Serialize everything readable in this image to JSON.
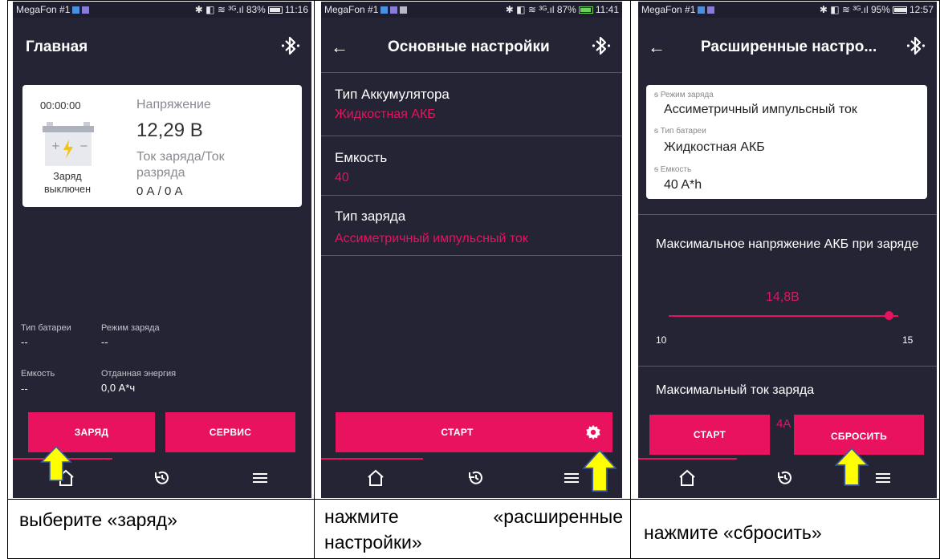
{
  "captions": {
    "c1": "выберите «заряд»",
    "c2_line1": "нажмите «расширенные",
    "c2_line2": "настройки»",
    "c3": "нажмите «сбросить»"
  },
  "screen1": {
    "status": {
      "carrier": "MegaFon #1",
      "right": "✱ ◧ ≋ ³ᴳ.ıl 83%",
      "time": "11:16"
    },
    "title": "Главная",
    "card": {
      "timer": "00:00:00",
      "charge_state": "Заряд выключен",
      "voltage_label": "Напряжение",
      "voltage_value": "12,29 В",
      "current_label": "Ток заряда/Ток разряда",
      "current_value": "0 А / 0 А"
    },
    "info": {
      "battery_type_label": "Тип батареи",
      "battery_type_value": "--",
      "charge_mode_label": "Режим заряда",
      "charge_mode_value": "--",
      "capacity_label": "Емкость",
      "capacity_value": "--",
      "energy_label": "Отданная энергия",
      "energy_value": "0,0 А*ч"
    },
    "buttons": {
      "charge": "ЗАРЯД",
      "service": "СЕРВИС"
    }
  },
  "screen2": {
    "status": {
      "carrier": "MegaFon #1",
      "right": "✱ ◧ ≋ ³ᴳ.ıl 87%",
      "time": "11:41"
    },
    "title": "Основные настройки",
    "settings": [
      {
        "name": "Тип Аккумулятора",
        "value": "Жидкостная АКБ"
      },
      {
        "name": "Емкость",
        "value": "40"
      },
      {
        "name": "Тип заряда",
        "value": "Ассиметричный импульсный ток"
      }
    ],
    "buttons": {
      "start": "СТАРТ"
    }
  },
  "screen3": {
    "status": {
      "carrier": "MegaFon #1",
      "right": "✱ ◧ ≋ ³ᴳ.ıl 95%",
      "time": "12:57"
    },
    "title": "Расширенные настро...",
    "summary": [
      {
        "label": "Режим заряда",
        "value": "Ассиметричный импульсный ток"
      },
      {
        "label": "Тип батареи",
        "value": "Жидкостная АКБ"
      },
      {
        "label": "Емкость",
        "value": "40 A*h"
      }
    ],
    "max_voltage_label": "Максимальное напряжение АКБ при заряде",
    "slider": {
      "value_text": "14,8В",
      "min": "10",
      "max": "15",
      "value": 14.8,
      "range": [
        10,
        15
      ]
    },
    "max_current_label": "Максимальный ток заряда",
    "partial_value": "4А",
    "buttons": {
      "start": "СТАРТ",
      "reset": "СБРОСИТЬ"
    }
  },
  "colors": {
    "accent": "#e8125f",
    "background": "#252435",
    "arrow": "#ffff00"
  }
}
